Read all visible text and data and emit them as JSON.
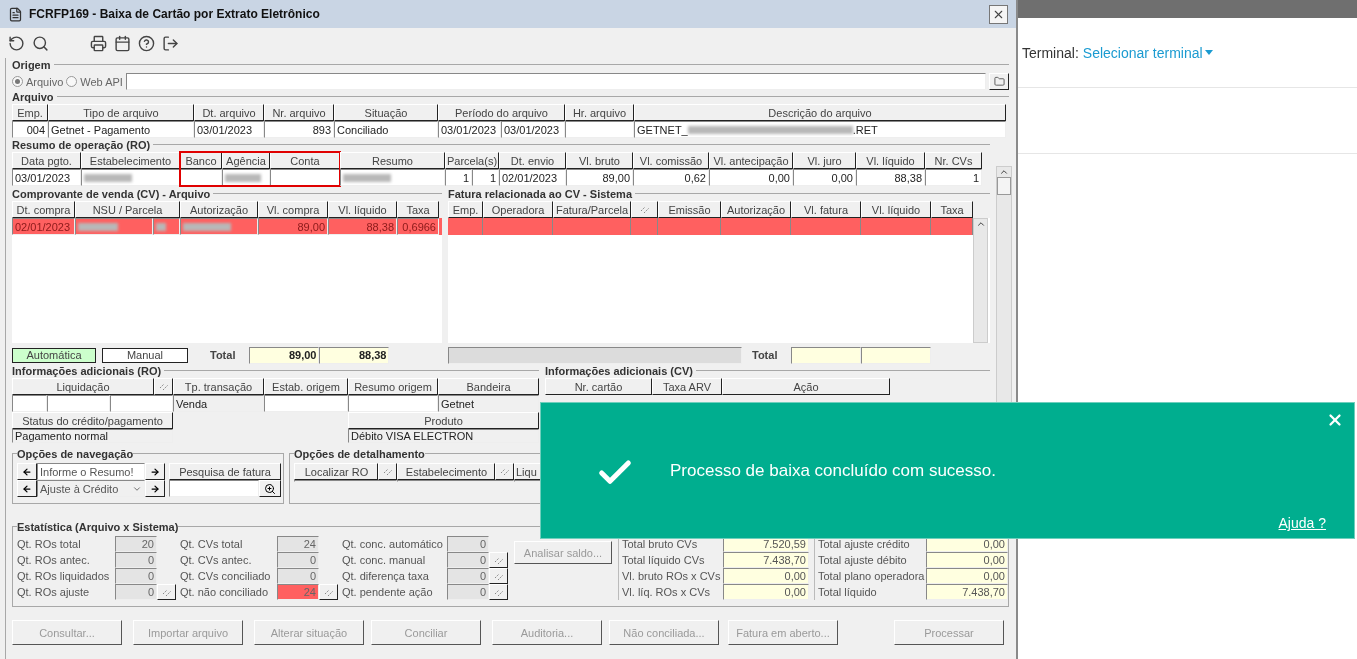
{
  "window": {
    "title": "FCRFP169 - Baixa de Cartão por Extrato Eletrônico"
  },
  "origem": {
    "title": "Origem",
    "options": [
      {
        "label": "Arquivo",
        "selected": true
      },
      {
        "label": "Web API",
        "selected": false
      }
    ]
  },
  "arquivo": {
    "title": "Arquivo",
    "columns": [
      {
        "label": "Emp.",
        "values": [
          "004"
        ]
      },
      {
        "label": "Tipo de arquivo",
        "values": [
          "Getnet - Pagamento"
        ]
      },
      {
        "label": "Dt. arquivo",
        "values": [
          "03/01/2023"
        ]
      },
      {
        "label": "Nr. arquivo",
        "values": [
          "893"
        ]
      },
      {
        "label": "Situação",
        "values": [
          "Conciliado"
        ]
      },
      {
        "label": "Período do arquivo",
        "values": [
          "03/01/2023",
          "03/01/2023"
        ]
      },
      {
        "label": "Hr. arquivo"
      },
      {
        "label": "Descrição do arquivo",
        "values": [
          {
            "prefix": "GETNET_",
            "suffix": ".RET",
            "redacted": true
          }
        ]
      }
    ]
  },
  "ro": {
    "title": "Resumo de operação (RO)",
    "columns": [
      {
        "label": "Data pgto.",
        "highlighted": false,
        "values": [
          "03/01/2023"
        ]
      },
      {
        "label": "Estabelecimento",
        "highlighted": false,
        "values": [
          {
            "redacted": true
          }
        ]
      },
      {
        "label": "Banco",
        "highlighted": true
      },
      {
        "label": "Agência",
        "highlighted": true,
        "values": [
          {
            "redacted": true
          }
        ]
      },
      {
        "label": "Conta",
        "highlighted": true
      },
      {
        "label": "Resumo",
        "highlighted": false,
        "values": [
          {
            "redacted": true
          }
        ]
      },
      {
        "label": "Parcela(s)",
        "highlighted": false,
        "values": [
          "1",
          "1"
        ]
      },
      {
        "label": "Dt. envio",
        "highlighted": false,
        "values": [
          "02/01/2023"
        ]
      },
      {
        "label": "Vl. bruto",
        "highlighted": false,
        "values": [
          "89,00"
        ]
      },
      {
        "label": "Vl. comissão",
        "highlighted": false,
        "values": [
          "0,62"
        ]
      },
      {
        "label": "Vl. antecipação",
        "highlighted": false,
        "values": [
          "0,00"
        ]
      },
      {
        "label": "Vl. juro",
        "highlighted": false,
        "values": [
          "0,00"
        ]
      },
      {
        "label": "Vl. líquido",
        "highlighted": false,
        "values": [
          "88,38"
        ]
      },
      {
        "label": "Nr. CVs",
        "highlighted": false,
        "values": [
          "1"
        ]
      }
    ]
  },
  "cv": {
    "title": "Comprovante de venda (CV) - Arquivo",
    "columns": [
      "Dt. compra",
      "NSU / Parcela",
      "Autorização",
      "Vl. compra",
      "Vl. líquido",
      "Taxa"
    ],
    "rows": [
      {
        "selected": true,
        "cells": [
          "02/01/2023",
          {
            "redacted": true,
            "split": true
          },
          {
            "redacted": true
          },
          "89,00",
          "88,38",
          "0,6966"
        ]
      }
    ],
    "legend": [
      {
        "label": "Automática",
        "color": "#ccffcc"
      },
      {
        "label": "Manual",
        "color": "#ffffff"
      }
    ],
    "total_label": "Total",
    "totals": [
      "89,00",
      "88,38"
    ]
  },
  "fatura": {
    "title": "Fatura relacionada ao CV - Sistema",
    "columns": [
      {
        "kind": "text",
        "label": "Emp."
      },
      {
        "kind": "text",
        "label": "Operadora"
      },
      {
        "kind": "text",
        "label": "Fatura/Parcela"
      },
      {
        "kind": "icon"
      },
      {
        "kind": "text",
        "label": "Emissão"
      },
      {
        "kind": "text",
        "label": "Autorização"
      },
      {
        "kind": "text",
        "label": "Vl. fatura"
      },
      {
        "kind": "text",
        "label": "Vl. líquido"
      },
      {
        "kind": "text",
        "label": "Taxa"
      }
    ],
    "rows": [
      {
        "selected": true
      }
    ],
    "total_label": "Total"
  },
  "info_ro": {
    "title": "Informações adicionais (RO)",
    "fields": [
      {
        "kind": "split",
        "label": "Liquidação"
      },
      {
        "kind": "single",
        "label": "Tp. transação",
        "value": "Venda"
      },
      {
        "kind": "single",
        "label": "Estab. origem"
      },
      {
        "kind": "single",
        "label": "Resumo origem"
      },
      {
        "kind": "single",
        "label": "Bandeira",
        "value": "Getnet"
      }
    ],
    "fields_2": [
      {
        "label": "Status do crédito/pagamento",
        "value": "Pagamento normal"
      },
      {
        "label": "Produto",
        "value": "Débito VISA ELECTRON"
      }
    ]
  },
  "info_cv": {
    "title": "Informações adicionais (CV)",
    "columns": [
      "Nr. cartão",
      "Taxa ARV",
      "Ação"
    ]
  },
  "navegacao": {
    "title": "Opções de navegação",
    "rows": [
      {
        "kind": "text",
        "value": "Informe o Resumo!"
      },
      {
        "kind": "select",
        "value": "Ajuste à Crédito"
      }
    ],
    "search_label": "Pesquisa de fatura"
  },
  "detalhamento": {
    "title": "Opções de detalhamento",
    "columns": [
      {
        "label": "Localizar RO",
        "button": true
      },
      {
        "label": "Estabelecimento",
        "button": true
      },
      {
        "label": "Liqu",
        "button": false
      }
    ]
  },
  "estatistica": {
    "title": "Estatística (Arquivo x Sistema)",
    "groups": [
      [
        {
          "label": "Qt. ROs total",
          "value": "20",
          "alert": false,
          "button": false
        },
        {
          "label": "Qt. ROs antec.",
          "value": "0",
          "alert": false,
          "button": false
        },
        {
          "label": "Qt. ROs liquidados",
          "value": "0",
          "alert": false,
          "button": false
        },
        {
          "label": "Qt. ROs ajuste",
          "value": "0",
          "alert": false,
          "button": true
        }
      ],
      [
        {
          "label": "Qt. CVs total",
          "value": "24",
          "alert": false,
          "button": false
        },
        {
          "label": "Qt. CVs antec.",
          "value": "0",
          "alert": false,
          "button": false
        },
        {
          "label": "Qt. CVs conciliado",
          "value": "0",
          "alert": false,
          "button": false
        },
        {
          "label": "Qt. não conciliado",
          "value": "24",
          "alert": true,
          "button": true
        }
      ],
      [
        {
          "label": "Qt. conc. automático",
          "value": "0",
          "alert": false,
          "button": false
        },
        {
          "label": "Qt. conc. manual",
          "value": "0",
          "alert": false,
          "button": true
        },
        {
          "label": "Qt. diferença taxa",
          "value": "0",
          "alert": false,
          "button": true
        },
        {
          "label": "Qt. pendente ação",
          "value": "0",
          "alert": false,
          "button": true
        }
      ]
    ],
    "analyze_button": {
      "label": "Analisar saldo...",
      "disabled": true
    },
    "totals": [
      [
        {
          "label": "Total bruto CVs",
          "value": "7.520,59"
        },
        {
          "label": "Total líquido CVs",
          "value": "7.438,70"
        },
        {
          "label": "Vl. bruto ROs x CVs",
          "value": "0,00"
        },
        {
          "label": "Vl. líq. ROs x CVs",
          "value": "0,00"
        }
      ],
      [
        {
          "label": "Total ajuste crédito",
          "value": "0,00"
        },
        {
          "label": "Total ajuste débito",
          "value": "0,00"
        },
        {
          "label": "Total plano operadora",
          "value": "0,00"
        },
        {
          "label": "Total líquido",
          "value": "7.438,70"
        }
      ]
    ]
  },
  "buttons": [
    {
      "label": "Consultar...",
      "disabled": true
    },
    {
      "label": "Importar arquivo",
      "disabled": true
    },
    {
      "label": "Alterar situação",
      "disabled": true
    },
    {
      "label": "Conciliar",
      "disabled": true
    },
    {
      "label": "Auditoria...",
      "disabled": true
    },
    {
      "label": "Não conciliada...",
      "disabled": true
    },
    {
      "label": "Fatura em aberto...",
      "disabled": true
    },
    {
      "label": "Processar",
      "disabled": true
    }
  ],
  "terminal": {
    "label": "Terminal:",
    "link": "Selecionar terminal"
  },
  "toast": {
    "message": "Processo de baixa concluído com sucesso.",
    "link": "Ajuda ?"
  }
}
